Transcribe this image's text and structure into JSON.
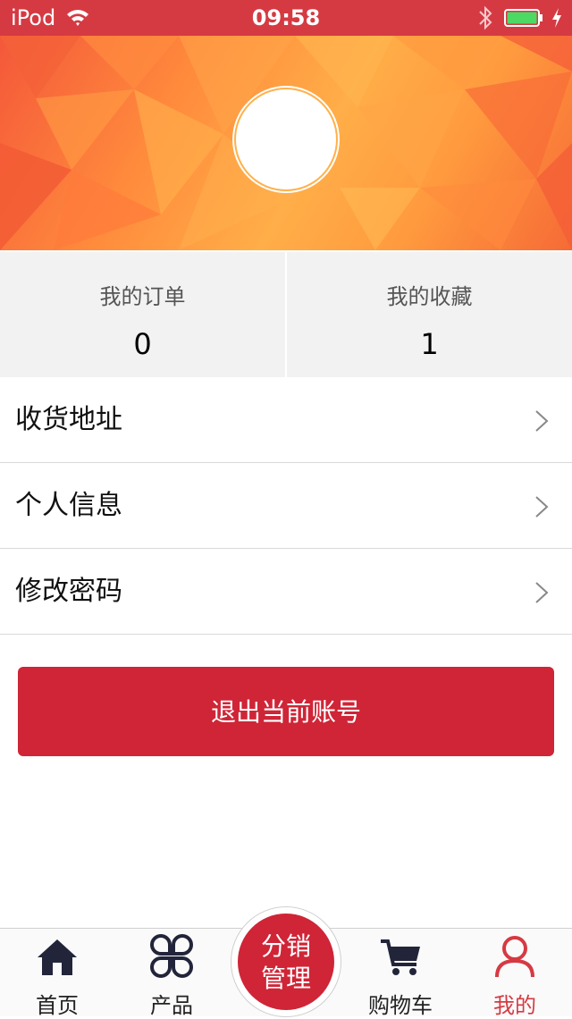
{
  "status_bar": {
    "carrier": "iPod",
    "time": "09:58",
    "icons": [
      "wifi-icon",
      "bluetooth-icon",
      "battery-icon",
      "charging-icon"
    ],
    "battery_level": 1.0,
    "background": "#d53a43"
  },
  "profile": {
    "avatar_icon": "user-avatar-icon"
  },
  "stats": [
    {
      "label": "我的订单",
      "value": "0"
    },
    {
      "label": "我的收藏",
      "value": "1"
    }
  ],
  "menu": [
    {
      "label": "收货地址",
      "icon": "chevron-right-icon"
    },
    {
      "label": "个人信息",
      "icon": "chevron-right-icon"
    },
    {
      "label": "修改密码",
      "icon": "chevron-right-icon"
    }
  ],
  "logout_label": "退出当前账号",
  "tabbar": {
    "tabs": [
      {
        "label": "首页",
        "icon": "home-icon"
      },
      {
        "label": "产品",
        "icon": "products-icon"
      },
      {
        "label": "购物车",
        "icon": "cart-icon"
      },
      {
        "label": "我的",
        "icon": "user-icon",
        "active": true
      }
    ],
    "center": {
      "line1": "分销",
      "line2": "管理"
    }
  },
  "colors": {
    "accent": "#cf2537",
    "header_orange": "#ff9a3e",
    "stats_bg": "#f2f2f2"
  }
}
